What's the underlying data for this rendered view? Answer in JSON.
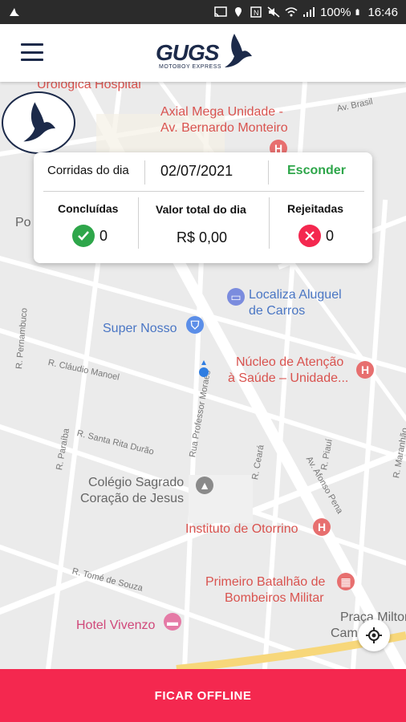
{
  "status_bar": {
    "battery": "100%",
    "time": "16:46"
  },
  "app_bar": {
    "logo_text": "GUGS",
    "logo_subtext": "MOTOBOY EXPRESS"
  },
  "card": {
    "label_day": "Corridas do dia",
    "date": "02/07/2021",
    "hide_label": "Esconder",
    "completed_title": "Concluídas",
    "completed_value": "0",
    "total_title": "Valor total do dia",
    "total_value": "R$ 0,00",
    "rejected_title": "Rejeitadas",
    "rejected_value": "0"
  },
  "map": {
    "places": [
      {
        "name": "Urológica Hospital"
      },
      {
        "name": "Axial Mega Unidade -"
      },
      {
        "name": "Av. Bernardo Monteiro"
      },
      {
        "name": "Localiza Aluguel"
      },
      {
        "name": "de Carros"
      },
      {
        "name": "Super Nosso"
      },
      {
        "name": "Núcleo de Atenção"
      },
      {
        "name": "à Saúde – Unidade..."
      },
      {
        "name": "Colégio Sagrado"
      },
      {
        "name": "Coração de Jesus"
      },
      {
        "name": "Instituto de Otorrino"
      },
      {
        "name": "Primeiro Batalhão de"
      },
      {
        "name": "Bombeiros Militar"
      },
      {
        "name": "Hotel Vivenzo"
      },
      {
        "name": "Praça Milton"
      },
      {
        "name": "Cam"
      },
      {
        "name": "Po"
      }
    ],
    "streets": [
      "Av. Brasil",
      "R. Pernambuco",
      "R. Cláudio Manoel",
      "R. Santa Rita Durão",
      "R. Paraíba",
      "Rua Professor Moraes",
      "R. Ceará",
      "Av. Afonso Pena",
      "R. Piauí",
      "R. Maranhão",
      "R. Tomé de Souza"
    ]
  },
  "bottom_button": {
    "label": "FICAR OFFLINE"
  },
  "colors": {
    "accent": "#f4284f",
    "success": "#2ea64a",
    "brand": "#1c2a4a"
  }
}
